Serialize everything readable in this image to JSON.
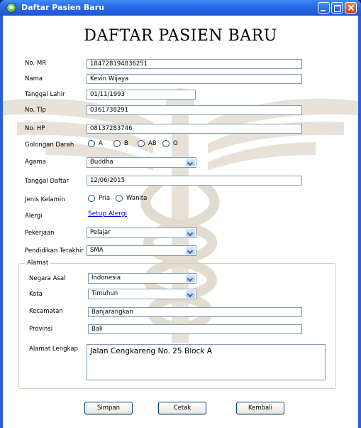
{
  "window": {
    "title": "Daftar Pasien Baru"
  },
  "form": {
    "heading": "DAFTAR PASIEN BARU",
    "no_mr": {
      "label": "No. MR",
      "value": "184728194836251"
    },
    "nama": {
      "label": "Nama",
      "value": "Kevin Wijaya"
    },
    "tanggal_lahir": {
      "label": "Tanggal Lahir",
      "value": "01/11/1993"
    },
    "no_tlp": {
      "label": "No. Tlp",
      "value": "0361738291"
    },
    "no_hp": {
      "label": "No. HP",
      "value": "08137283746"
    },
    "golongan_darah": {
      "label": "Golongan Darah",
      "options": [
        "A",
        "B",
        "AB",
        "O"
      ]
    },
    "agama": {
      "label": "Agama",
      "value": "Buddha"
    },
    "tanggal_daftar": {
      "label": "Tanggal Daftar",
      "value": "12/06/2015"
    },
    "jenis_kelamin": {
      "label": "Jenis Kelamin",
      "options": [
        "Pria",
        "Wanita"
      ]
    },
    "alergi": {
      "label": "Alergi",
      "link": "Setup Alergi"
    },
    "pekerjaan": {
      "label": "Pekerjaan",
      "value": "Pelajar"
    },
    "pendidikan": {
      "label": "Pendidikan Terakhir",
      "value": "SMA"
    }
  },
  "alamat": {
    "group_label": "Alamat",
    "negara": {
      "label": "Negara Asal",
      "value": "Indonesia"
    },
    "kota": {
      "label": "Kota",
      "value": "Timuhun"
    },
    "kecamatan": {
      "label": "Kecamatan",
      "value": "Banjarangkan"
    },
    "provinsi": {
      "label": "Provinsi",
      "value": "Bali"
    },
    "alamat_lengkap": {
      "label": "Alamat Lengkap",
      "value": "Jalan Cengkareng No. 25 Block A"
    }
  },
  "buttons": {
    "simpan": "Simpan",
    "cetak": "Cetak",
    "kembali": "Kembali"
  },
  "colors": {
    "titlebar": "#2a6ce8",
    "field_border": "#7f9db9",
    "link": "#0000ee",
    "watermark": "#ded7cc"
  },
  "icons": {
    "app": "app-icon",
    "minimize": "minimize-icon",
    "maximize": "maximize-icon",
    "close": "close-icon",
    "dropdown": "chevron-down-icon"
  }
}
